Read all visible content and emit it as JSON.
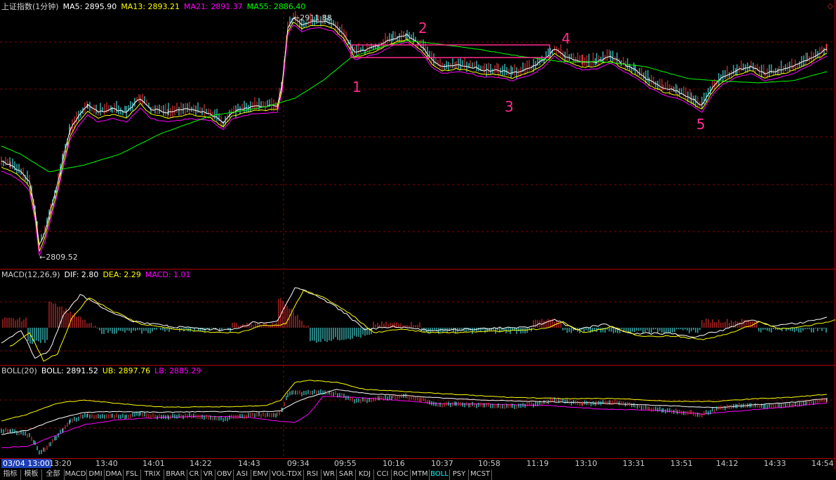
{
  "main": {
    "legend": {
      "title": "上证指数(1分钟)",
      "ma5": "MA5: 2895.90",
      "ma13": "MA13: 2893.21",
      "ma21": "MA21: 2891.37",
      "ma55": "MA55: 2886.40"
    },
    "high_label": "2911.88",
    "low_label": "2809.52",
    "annotations": [
      "1",
      "2",
      "3",
      "4",
      "5"
    ],
    "corner_icon": "diamond-icon"
  },
  "macd": {
    "name": "MACD(12,26,9)",
    "dif": "DIF: 2.80",
    "dea": "DEA: 2.29",
    "macd": "MACD: 1.01"
  },
  "boll": {
    "name": "BOLL(20)",
    "boll": "BOLL: 2891.52",
    "ub": "UB: 2897.76",
    "lb": "LB: 2885.29"
  },
  "time_axis": {
    "date": "03/04 13:00",
    "ticks": [
      "13:20",
      "13:40",
      "14:01",
      "14:22",
      "14:43",
      "09:34",
      "09:55",
      "10:16",
      "10:37",
      "10:58",
      "11:19",
      "13:10",
      "13:31",
      "13:51",
      "14:12",
      "14:33",
      "14:54"
    ]
  },
  "tabs": [
    "指标",
    "模板",
    "全部",
    "MACD",
    "DMI",
    "DMA",
    "FSL",
    "TRIX",
    "BRAR",
    "CR",
    "VR",
    "OBV",
    "ASI",
    "EMV",
    "VOL-TDX",
    "RSI",
    "WR",
    "SAR",
    "KDJ",
    "CCI",
    "ROC",
    "MTM",
    "BOLL",
    "PSY",
    "MCST"
  ],
  "active_tab": "BOLL",
  "colors": {
    "ma5": "#ffffff",
    "ma13": "#ffff00",
    "ma21": "#ff00ff",
    "ma55": "#00ff00",
    "annotation": "#ff2b8e",
    "macd_up": "#ff3333",
    "macd_down": "#54ffff",
    "grid": "#8b0000"
  }
}
